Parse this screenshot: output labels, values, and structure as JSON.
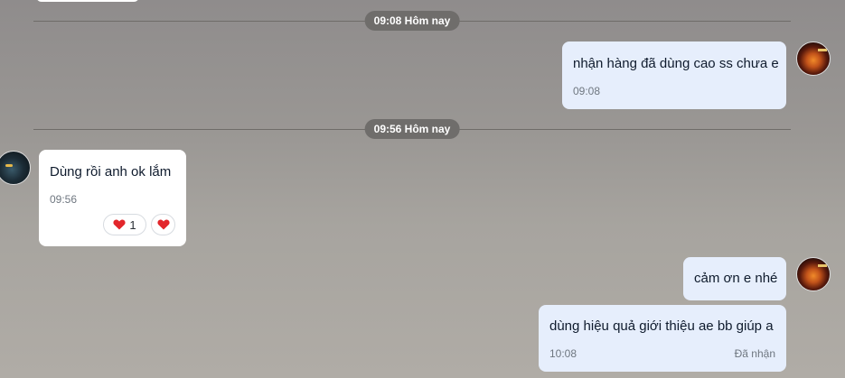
{
  "separators": [
    {
      "label": "09:08 Hôm nay"
    },
    {
      "label": "09:56 Hôm nay"
    }
  ],
  "messages": [
    {
      "text": "nhận hàng đã dùng cao ss chưa e",
      "time": "09:08"
    },
    {
      "text": "Dùng rồi anh ok lắm",
      "time": "09:56",
      "reaction_count": "1"
    },
    {
      "text": "cảm ơn e nhé"
    },
    {
      "text": "dùng hiệu quả giới thiệu ae bb giúp a",
      "time": "10:08",
      "status": "Đã nhận"
    }
  ],
  "colors": {
    "my_bubble": "#e6eefc",
    "their_bubble": "#ffffff",
    "pill_bg": "#6f6d6b",
    "heart": "#e2262b"
  },
  "icons": {
    "reaction": "heart-icon"
  }
}
